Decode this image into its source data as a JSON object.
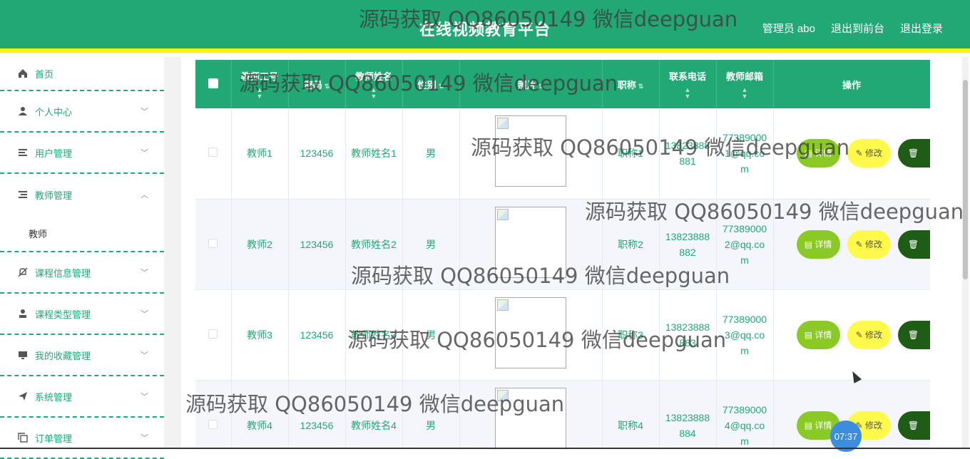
{
  "header": {
    "title": "在线视频教育平台",
    "admin": "管理员 abo",
    "to_front": "退出到前台",
    "logout": "退出登录"
  },
  "sidebar": {
    "items": [
      {
        "label": "首页",
        "icon": "home-icon"
      },
      {
        "label": "个人中心",
        "icon": "user-icon"
      },
      {
        "label": "用户管理",
        "icon": "list-icon"
      },
      {
        "label": "教师管理",
        "icon": "list-icon"
      },
      {
        "label": "教师",
        "icon": ""
      },
      {
        "label": "课程信息管理",
        "icon": "bell-off-icon"
      },
      {
        "label": "课程类型管理",
        "icon": "user-icon"
      },
      {
        "label": "我的收藏管理",
        "icon": "monitor-icon"
      },
      {
        "label": "系统管理",
        "icon": "send-icon"
      },
      {
        "label": "订单管理",
        "icon": "copy-icon"
      }
    ]
  },
  "table": {
    "headers": [
      "教师工号",
      "密码",
      "教师姓名",
      "性别",
      "照片",
      "职称",
      "联系电话",
      "教师邮箱",
      "操作"
    ],
    "rows": [
      {
        "id": "教师1",
        "pwd": "123456",
        "name": "教师姓名1",
        "sex": "男",
        "title": "职称1",
        "phone": "13823888881",
        "email": "773890001@qq.com"
      },
      {
        "id": "教师2",
        "pwd": "123456",
        "name": "教师姓名2",
        "sex": "男",
        "title": "职称2",
        "phone": "13823888882",
        "email": "773890002@qq.com"
      },
      {
        "id": "教师3",
        "pwd": "123456",
        "name": "教师姓名3",
        "sex": "男",
        "title": "职称3",
        "phone": "13823888883",
        "email": "773890003@qq.com"
      },
      {
        "id": "教师4",
        "pwd": "123456",
        "name": "教师姓名4",
        "sex": "男",
        "title": "职称4",
        "phone": "13823888884",
        "email": "773890004@qq.com"
      }
    ],
    "btn_detail": "详情",
    "btn_edit": "修改"
  },
  "watermark": "源码获取 QQ86050149 微信deepguan",
  "clock": "07:37",
  "colors": {
    "primary": "#21a875",
    "accent": "#fff200",
    "detail": "#8ac926",
    "edit": "#fff94c",
    "delete": "#1f5d17"
  }
}
